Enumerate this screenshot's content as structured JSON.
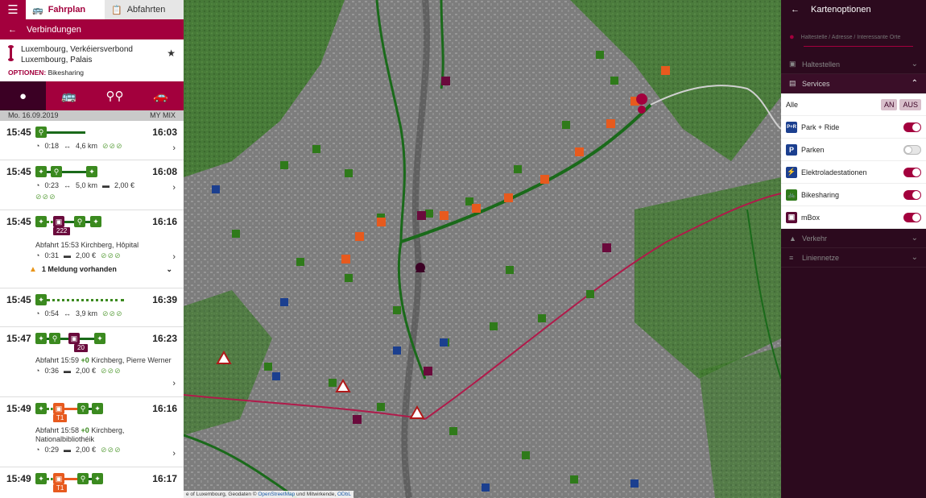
{
  "topbar": {
    "tab_fahrplan": "Fahrplan",
    "tab_abfahrten": "Abfahrten"
  },
  "subbar": {
    "title": "Verbindungen"
  },
  "route": {
    "from": "Luxembourg, Verkéiersverbond",
    "to": "Luxembourg, Palais",
    "options_label": "OPTIONEN:",
    "options_value": "Bikesharing"
  },
  "datebar": {
    "date": "Mo. 16.09.2019",
    "mix": "MY MIX"
  },
  "connections": [
    {
      "dep": "15:45",
      "arr": "16:03",
      "dur": "0:18",
      "dist": "4,6 km",
      "price": "",
      "leaves": "⊘⊘⊘"
    },
    {
      "dep": "15:45",
      "arr": "16:08",
      "dur": "0:23",
      "dist": "5,0 km",
      "price": "2,00 €",
      "leaves": "⊘⊘⊘"
    },
    {
      "dep": "15:45",
      "arr": "16:16",
      "line": "222",
      "info": "Abfahrt 15:53 Kirchberg, Hôpital",
      "dur": "0:31",
      "price": "2,00 €",
      "leaves": "⊘⊘⊘",
      "notice": "1 Meldung vorhanden"
    },
    {
      "dep": "15:45",
      "arr": "16:39",
      "dur": "0:54",
      "dist": "3,9 km",
      "leaves": "⊘⊘⊘"
    },
    {
      "dep": "15:47",
      "arr": "16:23",
      "line": "20",
      "info_pre": "Abfahrt 15:59 ",
      "info_delay": "+0",
      "info_post": " Kirchberg, Pierre Werner",
      "dur": "0:36",
      "price": "2,00 €",
      "leaves": "⊘⊘⊘"
    },
    {
      "dep": "15:49",
      "arr": "16:16",
      "line": "T1",
      "info_pre": "Abfahrt 15:58 ",
      "info_delay": "+0",
      "info_post": " Kirchberg, Nationalbibliothéik",
      "dur": "0:29",
      "price": "2,00 €",
      "leaves": "⊘⊘⊘"
    },
    {
      "dep": "15:49",
      "arr": "16:17",
      "line": "T1"
    }
  ],
  "map": {
    "attribution_pre": "e of Luxembourg, Geodaten © ",
    "attribution_osm": "OpenStreetMap",
    "attribution_mid": " und Mitwirkende, ",
    "attribution_odbl": "ODbL"
  },
  "right": {
    "title": "Kartenoptionen",
    "search_placeholder": "Haltestelle / Adresse / Interessante Orte",
    "sections": {
      "haltestellen": "Haltestellen",
      "services": "Services",
      "verkehr": "Verkehr",
      "liniennetze": "Liniennetze"
    },
    "alle": "Alle",
    "an": "AN",
    "aus": "AUS",
    "services": [
      {
        "label": "Park + Ride",
        "icon": "P+R",
        "color": "#1b3f8f",
        "on": true
      },
      {
        "label": "Parken",
        "icon": "P",
        "color": "#1b3f8f",
        "on": false
      },
      {
        "label": "Elektroladestationen",
        "icon": "⚡",
        "color": "#1b3f8f",
        "on": true
      },
      {
        "label": "Bikesharing",
        "icon": "🚲",
        "color": "#2f7a1a",
        "on": true
      },
      {
        "label": "mBox",
        "icon": "▣",
        "color": "#5a0a34",
        "on": true
      }
    ]
  },
  "colors": {
    "brand": "#a3003d",
    "dark": "#2c0a1e",
    "green": "#3b8a1f",
    "orange": "#e75a1e"
  }
}
